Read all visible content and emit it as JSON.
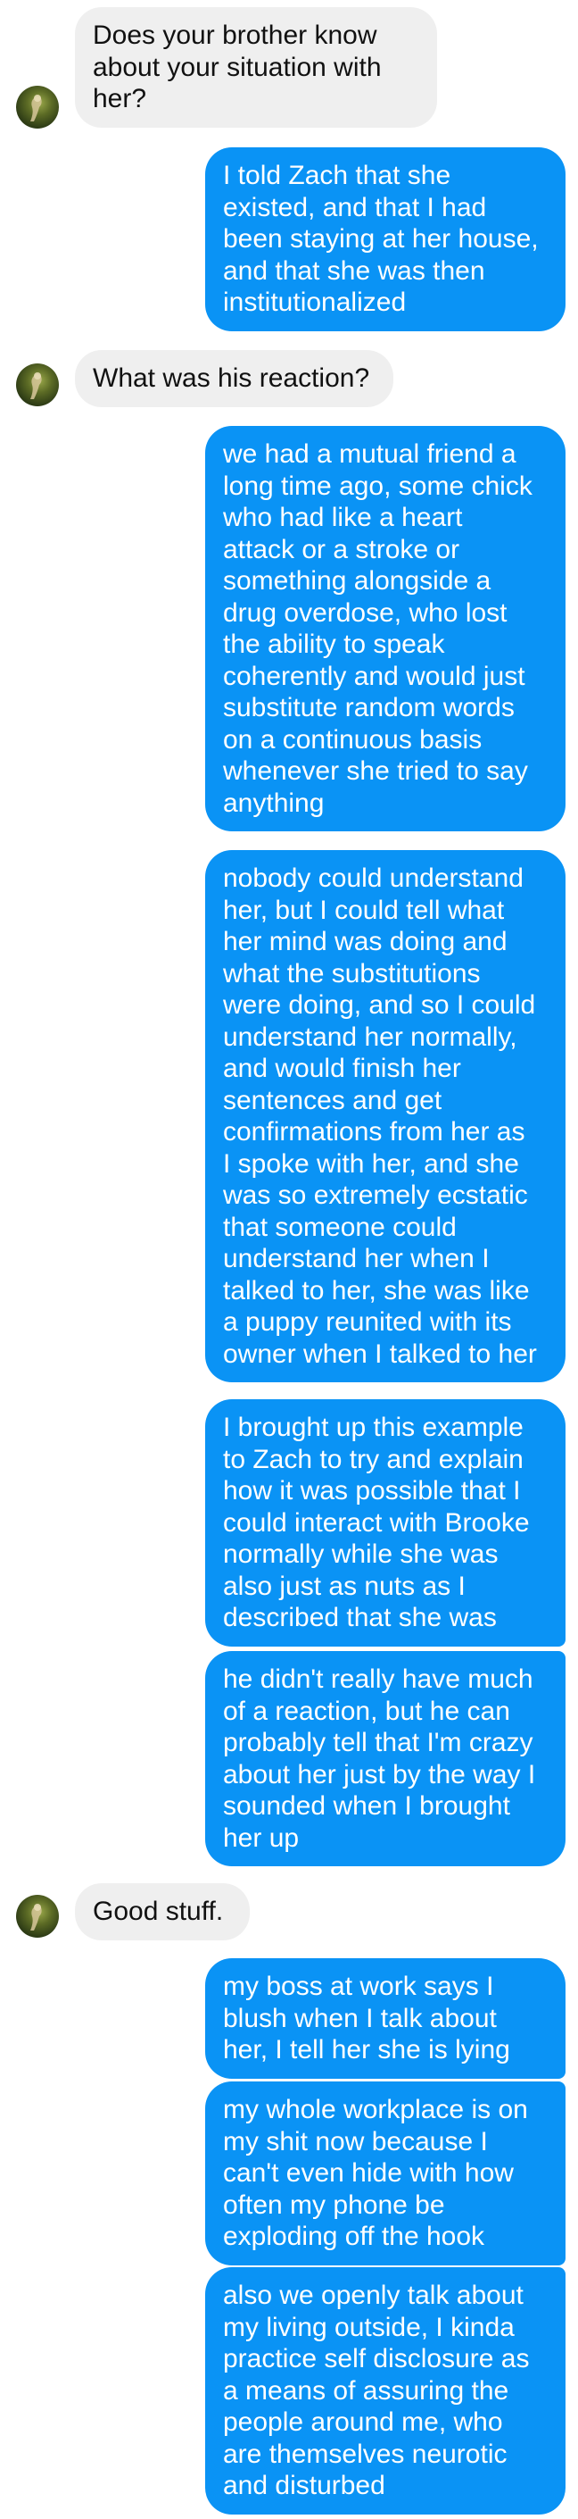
{
  "conversation": {
    "messages": [
      {
        "id": "m1",
        "sender": "contact",
        "text": "Does your brother know\nabout your situation with\nher?"
      },
      {
        "id": "m2",
        "sender": "me",
        "text": "I told Zach that she\nexisted, and that I had\nbeen staying at her house,\nand that she was then\ninstitutionalized"
      },
      {
        "id": "m3",
        "sender": "contact",
        "text": "What was his reaction?"
      },
      {
        "id": "m4",
        "sender": "me",
        "text": "we had a mutual friend a\nlong time ago, some chick\nwho had like a heart\nattack or a stroke or\nsomething alongside a\ndrug overdose, who lost\nthe ability to speak\ncoherently and would just\nsubstitute random words\non a continuous basis\nwhenever she tried to say\nanything"
      },
      {
        "id": "m5",
        "sender": "me",
        "text": "nobody could understand\nher, but I could tell what\nher mind was doing and\nwhat the substitutions\nwere doing, and so I could\nunderstand her normally,\nand would finish her\nsentences and get\nconfirmations from her as\nI spoke with her, and she\nwas so extremely ecstatic\nthat someone could\nunderstand her when I\ntalked to her, she was like\na puppy reunited with its\nowner when I talked to her"
      },
      {
        "id": "m6",
        "sender": "me",
        "text": "I brought up this example\nto Zach to try and explain\nhow it was possible that I\ncould interact with Brooke\nnormally while she was\nalso just as nuts as I\ndescribed that she was"
      },
      {
        "id": "m7",
        "sender": "me",
        "text": "he didn't really have much\nof a reaction, but he can\nprobably tell that I'm crazy\nabout her just by the way I\nsounded when I brought\nher up"
      },
      {
        "id": "m8",
        "sender": "contact",
        "text": "Good stuff."
      },
      {
        "id": "m9",
        "sender": "me",
        "text": "my boss at work says I\nblush when I talk about\nher, I tell her she is lying"
      },
      {
        "id": "m10",
        "sender": "me",
        "text": "my whole workplace is on\nmy shit now because I\ncan't even hide with how\noften my phone be\nexploding off the hook"
      },
      {
        "id": "m11",
        "sender": "me",
        "text": "also we openly talk about\nmy living outside, I kinda\npractice self disclosure as\na means of assuring the\npeople around me, who\nare themselves neurotic\nand disturbed"
      }
    ]
  },
  "contact": {
    "avatar_icon": "contact-avatar-photo"
  },
  "colors": {
    "outgoing_bubble": "#0a93f5",
    "incoming_bubble": "#efefef",
    "outgoing_text": "#ffffff",
    "incoming_text": "#111111"
  }
}
